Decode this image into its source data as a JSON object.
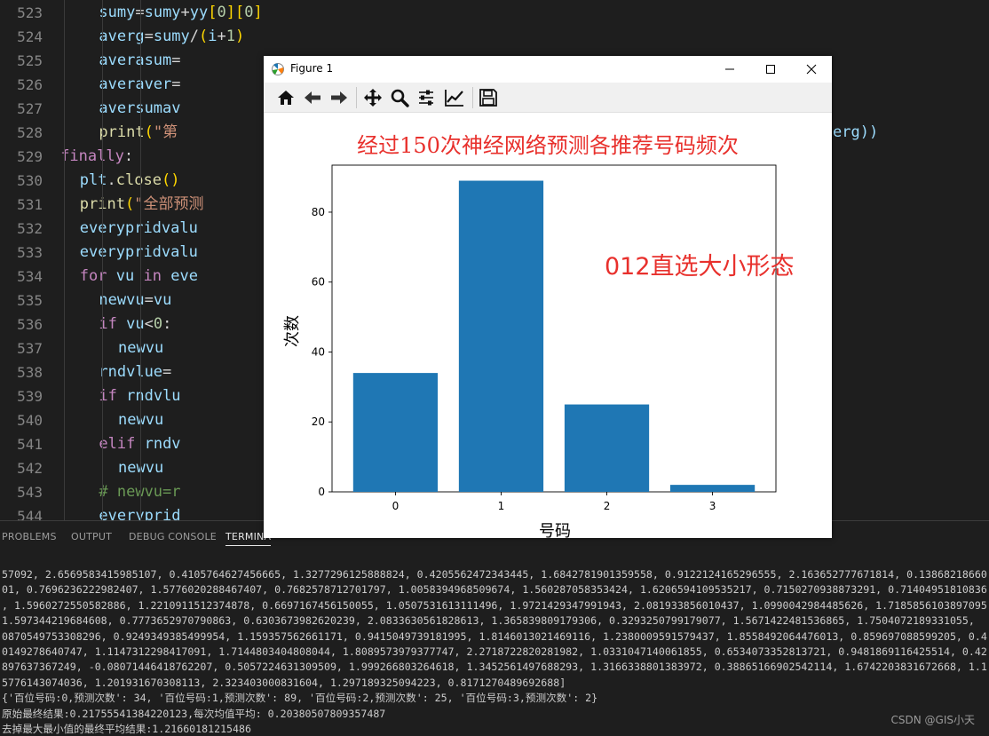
{
  "editor": {
    "line_numbers": [
      "523",
      "524",
      "525",
      "526",
      "527",
      "528",
      "529",
      "530",
      "531",
      "532",
      "533",
      "534",
      "535",
      "536",
      "537",
      "538",
      "539",
      "540",
      "541",
      "542",
      "543",
      "544"
    ],
    "lines": [
      [
        [
          "sumy",
          "var"
        ],
        [
          "=",
          "pl"
        ],
        [
          "sumy",
          "var"
        ],
        [
          "+",
          "pl"
        ],
        [
          "yy",
          "var"
        ],
        [
          "[",
          "par"
        ],
        [
          "0",
          "num"
        ],
        [
          "]",
          "par"
        ],
        [
          "[",
          "par"
        ],
        [
          "0",
          "num"
        ],
        [
          "]",
          "par"
        ]
      ],
      [
        [
          "averg",
          "var"
        ],
        [
          "=",
          "pl"
        ],
        [
          "sumy",
          "var"
        ],
        [
          "/",
          "pl"
        ],
        [
          "(",
          "par"
        ],
        [
          "i",
          "var"
        ],
        [
          "+",
          "pl"
        ],
        [
          "1",
          "num"
        ],
        [
          ")",
          "par"
        ]
      ],
      [
        [
          "averasum",
          "var"
        ],
        [
          "=",
          "pl"
        ]
      ],
      [
        [
          "averaver",
          "var"
        ],
        [
          "=",
          "pl"
        ]
      ],
      [
        [
          "aversumav",
          "var"
        ]
      ],
      [
        [
          "print",
          "fn"
        ],
        [
          "(",
          "par"
        ],
        [
          "\"第",
          "str"
        ]
      ],
      [
        [
          "finally",
          "kw"
        ],
        [
          ":",
          "pl"
        ]
      ],
      [
        [
          "plt",
          "var"
        ],
        [
          ".",
          "pl"
        ],
        [
          "close",
          "fn"
        ],
        [
          "(",
          "par"
        ],
        [
          ")",
          "par"
        ]
      ],
      [
        [
          "print",
          "fn"
        ],
        [
          "(",
          "par"
        ],
        [
          "\"全部预测",
          "str"
        ]
      ],
      [
        [
          "everypridvalu",
          "var"
        ]
      ],
      [
        [
          "everypridvalu",
          "var"
        ]
      ],
      [
        [
          "for",
          "kw"
        ],
        [
          " ",
          "pl"
        ],
        [
          "vu",
          "var"
        ],
        [
          " ",
          "pl"
        ],
        [
          "in",
          "kw"
        ],
        [
          " ",
          "pl"
        ],
        [
          "eve",
          "var"
        ]
      ],
      [
        [
          "newvu",
          "var"
        ],
        [
          "=",
          "pl"
        ],
        [
          "vu",
          "var"
        ]
      ],
      [
        [
          "if",
          "kw"
        ],
        [
          " ",
          "pl"
        ],
        [
          "vu",
          "var"
        ],
        [
          "<",
          "pl"
        ],
        [
          "0",
          "num"
        ],
        [
          ":",
          "pl"
        ]
      ],
      [
        [
          "newvu",
          "var"
        ]
      ],
      [
        [
          "rndvlue",
          "var"
        ],
        [
          "=",
          "pl"
        ]
      ],
      [
        [
          "if",
          "kw"
        ],
        [
          " ",
          "pl"
        ],
        [
          "rndvlu",
          "var"
        ]
      ],
      [
        [
          "newvu",
          "var"
        ]
      ],
      [
        [
          "elif",
          "kw"
        ],
        [
          " ",
          "pl"
        ],
        [
          "rndv",
          "var"
        ]
      ],
      [
        [
          "newvu",
          "var"
        ]
      ],
      [
        [
          "# newvu=r",
          "cm"
        ]
      ],
      [
        [
          "everyprid",
          "var"
        ]
      ]
    ],
    "line528_tail": "erg))"
  },
  "panel": {
    "tabs": [
      "PROBLEMS",
      "OUTPUT",
      "DEBUG CONSOLE",
      "TERMINA"
    ],
    "active_tab": 3
  },
  "terminal": {
    "lines": [
      "57092, 2.6569583415985107, 0.4105764627456665, 1.3277296125888824, 0.4205562472343445, 1.6842781901359558, 0.9122124165296555, 2.163652777671814, 0.13868218660",
      "01, 0.7696236222982407, 1.5776020288467407, 0.7682578712701797, 1.0058394968509674, 1.560287058353424, 1.6206594109535217, 0.7150270938873291, 0.71404951810836",
      ", 1.5960272550582886, 1.2210911512374878, 0.6697167456150055, 1.0507531613111496, 1.9721429347991943, 2.081933856010437, 1.0990042984485626, 1.7185856103897095",
      "1.597344219684608, 0.7773652970790863, 0.6303673982620239, 2.0833630561828613, 1.365839809179306, 0.3293250799179077, 1.5671422481536865, 1.7504072189331055,",
      "0870549753308296, 0.9249349385499954, 1.159357562661171, 0.9415049739181995, 1.8146013021469116, 1.2380009591579437, 1.8558492064476013, 0.859697088599205, 0.4",
      "0149278640747, 1.1147312298417091, 1.7144803404808044, 1.8089573979377747, 2.2718722820281982, 1.0331047140061855, 0.6534073352813721, 0.9481869116425514, 0.42",
      "897637367249, -0.08071446418762207, 0.5057224631309509, 1.999266803264618, 1.3452561497688293, 1.3166338801383972, 0.38865166902542114, 1.6742203831672668, 1.1",
      "5776143074036, 1.201931670308113, 2.323403000831604, 1.297189325094223, 0.8171270489692688]",
      "{'百位号码:0,预测次数': 34, '百位号码:1,预测次数': 89, '百位号码:2,预测次数': 25, '百位号码:3,预测次数': 2}",
      "原始最终结果:0.21755541384220123,每次均值平均: 0.20380507809357487",
      "去掉最大最小值的最终平均结果:1.21660181215486"
    ]
  },
  "watermark": "CSDN @GIS小天",
  "figure": {
    "window_title": "Figure 1",
    "annotation": "012直选大小形态",
    "toolbar_icons": [
      "home-icon",
      "back-arrow-icon",
      "forward-arrow-icon",
      "pan-move-icon",
      "zoom-magnifier-icon",
      "configure-subplots-icon",
      "edit-axis-icon",
      "save-floppy-icon"
    ]
  },
  "chart_data": {
    "type": "bar",
    "title": "经过150次神经网络预测各推荐号码频次",
    "xlabel": "号码",
    "ylabel": "次数",
    "categories": [
      "0",
      "1",
      "2",
      "3"
    ],
    "values": [
      34,
      89,
      25,
      2
    ],
    "ylim": [
      0,
      93.45
    ],
    "yticks": [
      0,
      20,
      40,
      60,
      80
    ],
    "bar_color": "#1f77b4",
    "title_color": "#e8302c",
    "grid": false
  }
}
